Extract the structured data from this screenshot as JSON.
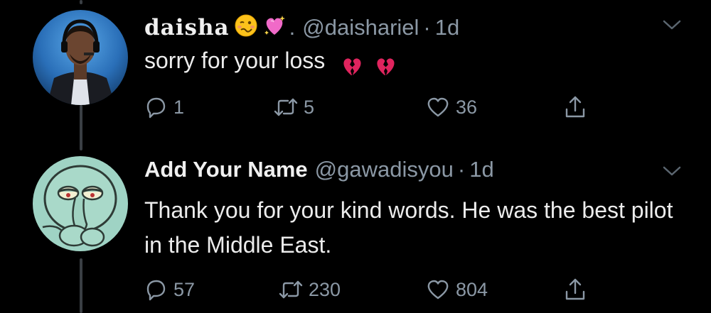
{
  "tweets": [
    {
      "display_name": "daisha",
      "name_emojis": [
        "woozy-face-emoji",
        "sparkling-heart-emoji"
      ],
      "name_suffix": ".",
      "handle": "@daishariel",
      "separator": "·",
      "age": "1d",
      "text": "sorry for your loss",
      "text_emojis": [
        "broken-heart-emoji",
        "broken-heart-emoji"
      ],
      "reply_count": "1",
      "retweet_count": "5",
      "like_count": "36"
    },
    {
      "display_name": "Add Your Name",
      "handle": "@gawadisyou",
      "separator": "·",
      "age": "1d",
      "text": "Thank you for your kind words. He was the best pilot in the Middle East.",
      "reply_count": "57",
      "retweet_count": "230",
      "like_count": "804"
    }
  ],
  "colors": {
    "background": "#000000",
    "primary_text": "#ececec",
    "secondary_text": "#8b98a5",
    "thread_line": "#3a3f44",
    "broken_heart": "#e0245e"
  },
  "icons": [
    "reply-icon",
    "retweet-icon",
    "like-icon",
    "share-icon",
    "chevron-down-icon"
  ]
}
